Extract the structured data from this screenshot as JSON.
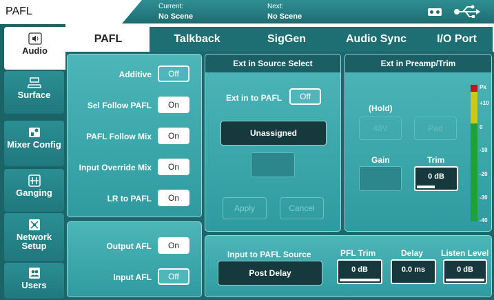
{
  "header": {
    "title": "PAFL",
    "current_label": "Current:",
    "current_value": "No Scene",
    "next_label": "Next:",
    "next_value": "No Scene"
  },
  "sidebar": {
    "items": [
      {
        "label": "Audio",
        "icon": "speaker-icon"
      },
      {
        "label": "Surface",
        "icon": "surface-icon"
      },
      {
        "label": "Mixer Config",
        "icon": "mixer-config-icon"
      },
      {
        "label": "Ganging",
        "icon": "ganging-icon"
      },
      {
        "label": "Network Setup",
        "icon": "network-icon"
      },
      {
        "label": "Users",
        "icon": "users-icon"
      }
    ],
    "active": "Audio"
  },
  "tabs": {
    "items": [
      "PAFL",
      "Talkback",
      "SigGen",
      "Audio Sync",
      "I/O Port"
    ],
    "active": "PAFL"
  },
  "pafl_options": {
    "additive_label": "Additive",
    "additive_value": "Off",
    "sel_follow_label": "Sel Follow PAFL",
    "sel_follow_value": "On",
    "follow_mix_label": "PAFL Follow Mix",
    "follow_mix_value": "On",
    "override_label": "Input Override Mix",
    "override_value": "On",
    "lr_label": "LR to PAFL",
    "lr_value": "On"
  },
  "afl_options": {
    "output_label": "Output AFL",
    "output_value": "On",
    "input_label": "Input AFL",
    "input_value": "Off"
  },
  "ext_source": {
    "heading": "Ext in Source Select",
    "ext_to_pafl_label": "Ext in to PAFL",
    "ext_to_pafl_value": "Off",
    "source_value": "Unassigned",
    "apply_label": "Apply",
    "cancel_label": "Cancel"
  },
  "ext_preamp": {
    "heading": "Ext in Preamp/Trim",
    "hold_label": "(Hold)",
    "left_btn_label": "48V",
    "right_btn_label": "Pad",
    "gain_label": "Gain",
    "trim_label": "Trim",
    "trim_value": "0 dB",
    "meter_ticks": [
      "Pk",
      "+10",
      "0",
      "-10",
      "-20",
      "-30",
      "-40"
    ]
  },
  "pafl_source": {
    "input_source_label": "Input to PAFL Source",
    "input_source_value": "Post Delay",
    "pfl_trim_label": "PFL Trim",
    "pfl_trim_value": "0 dB",
    "delay_label": "Delay",
    "delay_value": "0.0 ms",
    "listen_label": "Listen Level",
    "listen_value": "0 dB"
  },
  "colors": {
    "accent": "#2f9ba0",
    "header": "#1e6d72",
    "panel_head": "#1b5e63",
    "meter_green": "#1fa13a",
    "meter_yellow": "#c8c81e",
    "meter_red": "#b01e1e"
  }
}
